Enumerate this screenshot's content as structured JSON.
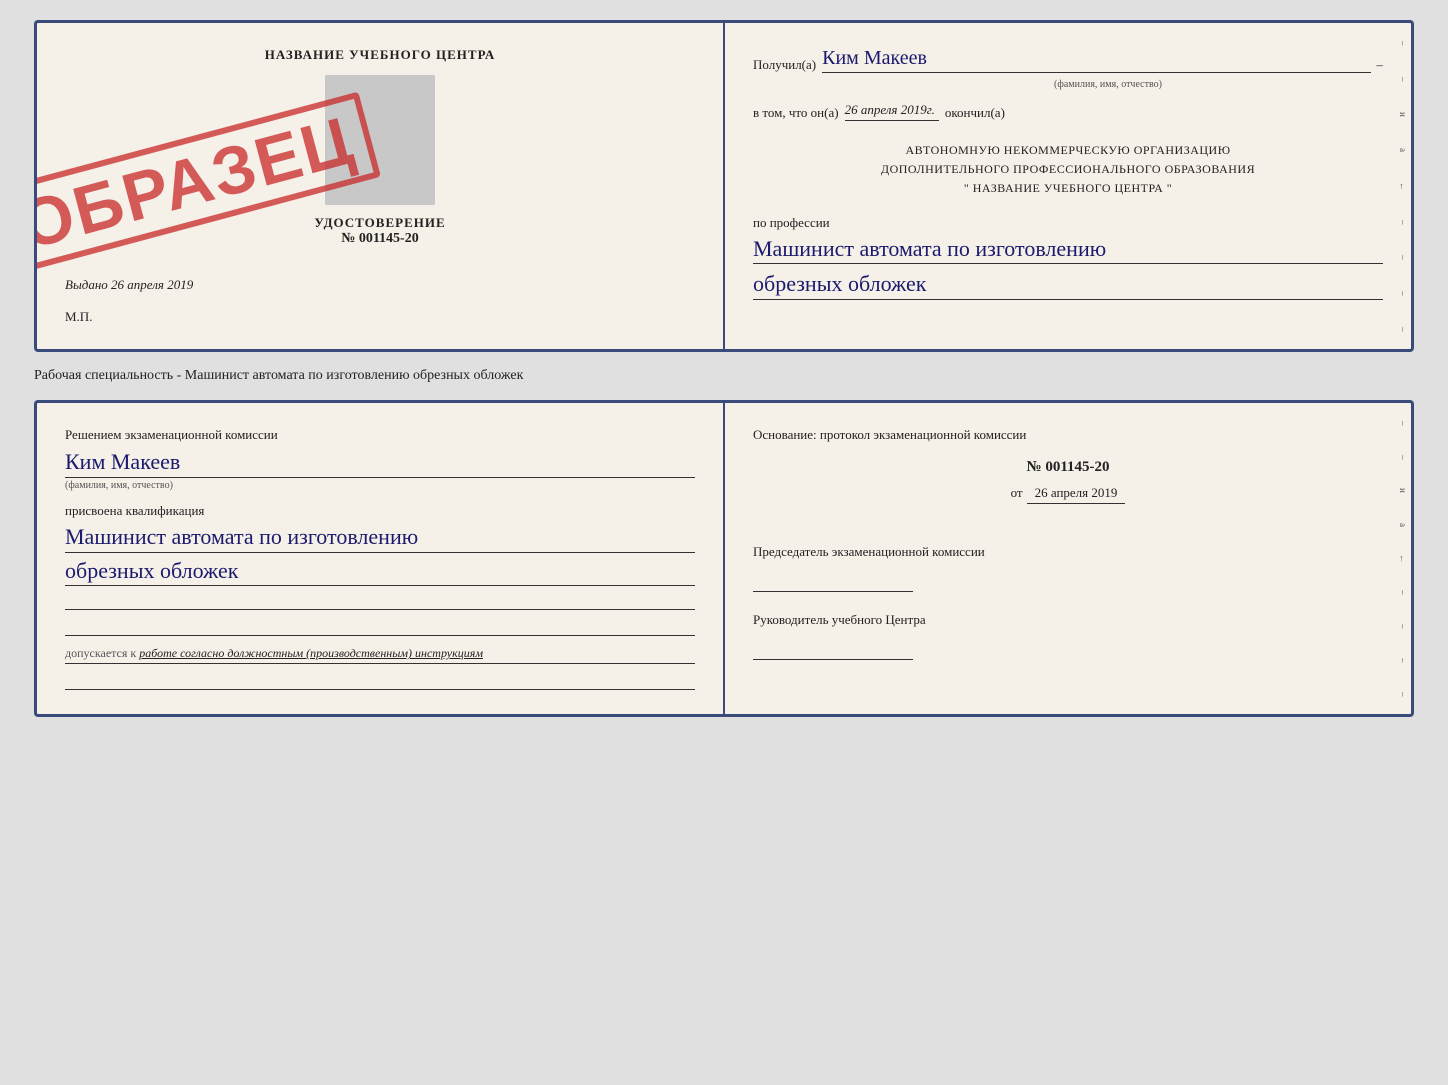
{
  "top_card": {
    "left": {
      "title": "НАЗВАНИЕ УЧЕБНОГО ЦЕНТРА",
      "udostoverenie": "УДОСТОВЕРЕНИЕ",
      "number": "№ 001145-20",
      "vydano_prefix": "Выдано",
      "vydano_date": "26 апреля 2019",
      "mp": "М.П.",
      "stamp": "ОБРАЗЕЦ"
    },
    "right": {
      "poluchil_label": "Получил(а)",
      "recipient_name": "Ким Макеев",
      "fio_sub": "(фамилия, имя, отчество)",
      "vtom_label": "в том, что он(а)",
      "date_value": "26 апреля 2019г.",
      "okonchil_label": "окончил(а)",
      "org_line1": "АВТОНОМНУЮ НЕКОММЕРЧЕСКУЮ ОРГАНИЗАЦИЮ",
      "org_line2": "ДОПОЛНИТЕЛЬНОГО ПРОФЕССИОНАЛЬНОГО ОБРАЗОВАНИЯ",
      "org_line3": "\"   НАЗВАНИЕ УЧЕБНОГО ЦЕНТРА   \"",
      "po_professii_label": "по профессии",
      "profession_line1": "Машинист автомата по изготовлению",
      "profession_line2": "обрезных обложек"
    }
  },
  "specialty_label": "Рабочая специальность - Машинист автомата по изготовлению обрезных обложек",
  "bottom_card": {
    "left": {
      "resheniem_label": "Решением экзаменационной комиссии",
      "name_hand": "Ким Макеев",
      "fio_sub": "(фамилия, имя, отчество)",
      "prisvoena_label": "присвоена квалификация",
      "qualification_line1": "Машинист автомата по изготовлению",
      "qualification_line2": "обрезных обложек",
      "dopuskaetsya_prefix": "допускается к",
      "dopuskaetsya_text": "работе согласно должностным (производственным) инструкциям"
    },
    "right": {
      "osnovanie_label": "Основание: протокол экзаменационной комиссии",
      "protocol_num": "№ 001145-20",
      "ot_prefix": "от",
      "ot_date": "26 апреля 2019",
      "predsedatel_label": "Председатель экзаменационной комиссии",
      "rukovoditel_label": "Руководитель учебного Центра"
    }
  },
  "decorations": {
    "right_marks": [
      "и",
      "а",
      "←",
      "–",
      "–",
      "–",
      "–",
      "–",
      "–"
    ]
  }
}
